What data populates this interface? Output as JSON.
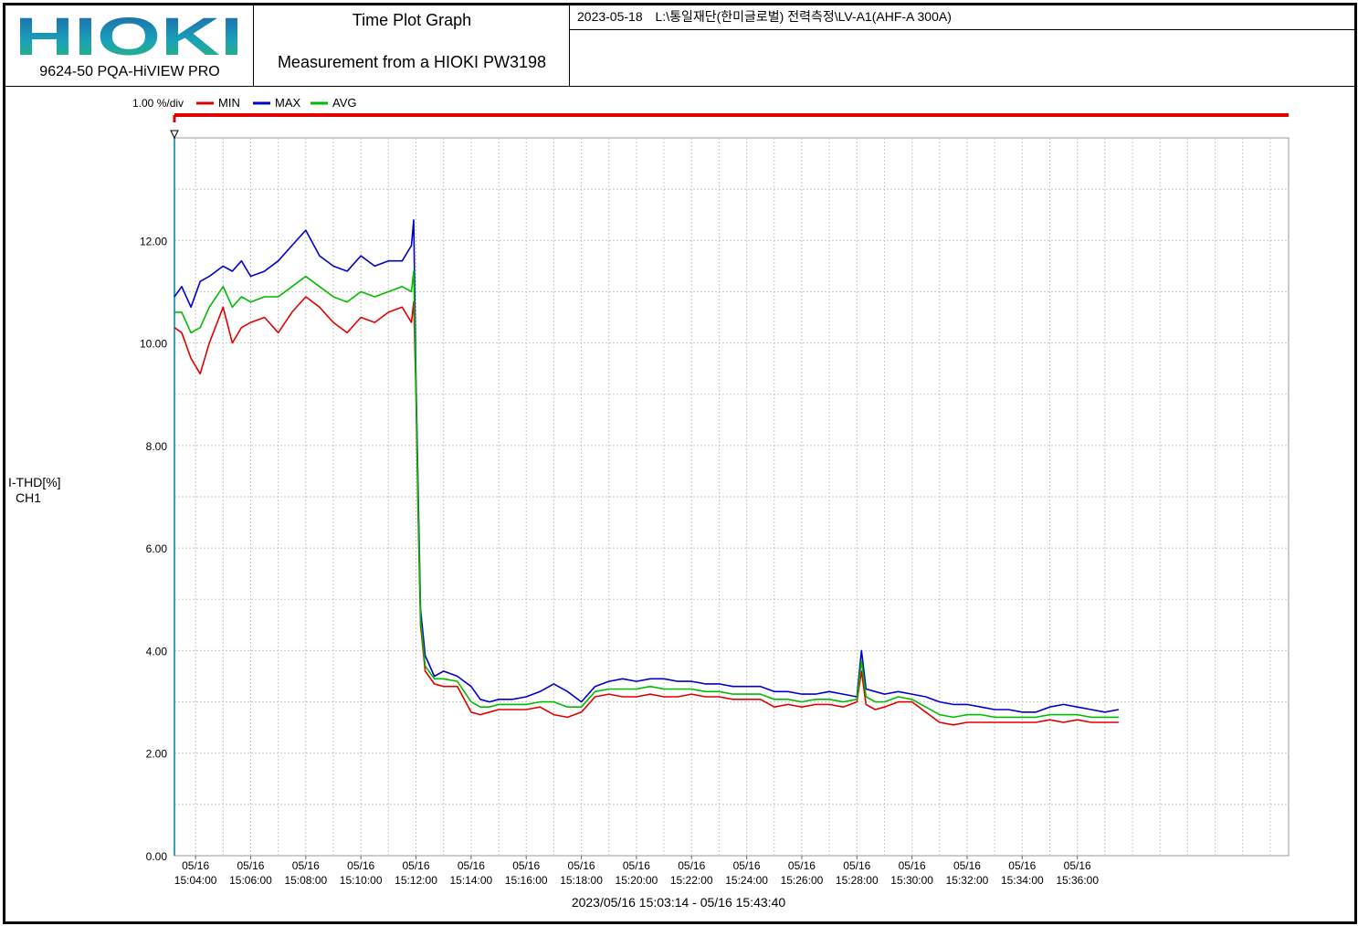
{
  "header": {
    "logo_text": "HIOKI",
    "product": "9624-50 PQA-HiVIEW PRO",
    "title": "Time Plot Graph",
    "subtitle": "Measurement from a HIOKI PW3198",
    "date": "2023-05-18",
    "path": "L:\\통일재단(한미글로벌) 전력측정\\LV-A1(AHF-A 300A)"
  },
  "colors": {
    "min": "#e00000",
    "max": "#0000cc",
    "avg": "#00bb00",
    "marker_bar": "#e00000",
    "cursor": "#3aa0c0",
    "grid": "#c8c8c8"
  },
  "chart_data": {
    "type": "line",
    "scale_label": "1.00 %/div",
    "ylabel": [
      "I-THD[%]",
      "CH1"
    ],
    "ylim": [
      0,
      14
    ],
    "yticks": [
      0,
      2,
      4,
      6,
      8,
      10,
      12
    ],
    "ytick_labels": [
      "0.00",
      "2.00",
      "4.00",
      "6.00",
      "8.00",
      "10.00",
      "12.00"
    ],
    "x_start": "15:03:14",
    "x_end": "15:43:40",
    "xticks": [
      "15:04:00",
      "15:06:00",
      "15:08:00",
      "15:10:00",
      "15:12:00",
      "15:14:00",
      "15:16:00",
      "15:18:00",
      "15:20:00",
      "15:22:00",
      "15:24:00",
      "15:26:00",
      "15:28:00",
      "15:30:00",
      "15:32:00",
      "15:34:00",
      "15:36:00"
    ],
    "xtick_dates": "05/16",
    "range_label": "2023/05/16 15:03:14 - 05/16 15:43:40",
    "x": [
      "15:03:14",
      "15:03:30",
      "15:03:50",
      "15:04:10",
      "15:04:30",
      "15:05:00",
      "15:05:20",
      "15:05:40",
      "15:06:00",
      "15:06:30",
      "15:07:00",
      "15:07:30",
      "15:08:00",
      "15:08:30",
      "15:09:00",
      "15:09:30",
      "15:10:00",
      "15:10:30",
      "15:11:00",
      "15:11:30",
      "15:11:50",
      "15:11:55",
      "15:12:00",
      "15:12:05",
      "15:12:10",
      "15:12:20",
      "15:12:40",
      "15:13:00",
      "15:13:30",
      "15:14:00",
      "15:14:20",
      "15:14:40",
      "15:15:00",
      "15:15:30",
      "15:16:00",
      "15:16:30",
      "15:17:00",
      "15:17:30",
      "15:18:00",
      "15:18:30",
      "15:19:00",
      "15:19:30",
      "15:20:00",
      "15:20:30",
      "15:21:00",
      "15:21:30",
      "15:22:00",
      "15:22:30",
      "15:23:00",
      "15:23:30",
      "15:24:00",
      "15:24:30",
      "15:25:00",
      "15:25:30",
      "15:26:00",
      "15:26:30",
      "15:27:00",
      "15:27:30",
      "15:28:00",
      "15:28:10",
      "15:28:20",
      "15:28:40",
      "15:29:00",
      "15:29:30",
      "15:30:00",
      "15:30:30",
      "15:31:00",
      "15:31:30",
      "15:32:00",
      "15:32:30",
      "15:33:00",
      "15:33:30",
      "15:34:00",
      "15:34:30",
      "15:35:00",
      "15:35:30",
      "15:36:00",
      "15:36:30",
      "15:37:00",
      "15:37:30"
    ],
    "series": [
      {
        "name": "MIN",
        "values": [
          10.3,
          10.2,
          9.7,
          9.4,
          10.0,
          10.7,
          10.0,
          10.3,
          10.4,
          10.5,
          10.2,
          10.6,
          10.9,
          10.7,
          10.4,
          10.2,
          10.5,
          10.4,
          10.6,
          10.7,
          10.4,
          10.8,
          9.0,
          6.5,
          4.5,
          3.6,
          3.35,
          3.3,
          3.3,
          2.8,
          2.75,
          2.8,
          2.85,
          2.85,
          2.85,
          2.9,
          2.75,
          2.7,
          2.8,
          3.1,
          3.15,
          3.1,
          3.1,
          3.15,
          3.1,
          3.1,
          3.15,
          3.1,
          3.1,
          3.05,
          3.05,
          3.05,
          2.9,
          2.95,
          2.9,
          2.95,
          2.95,
          2.9,
          3.0,
          3.6,
          2.95,
          2.85,
          2.9,
          3.0,
          3.0,
          2.8,
          2.6,
          2.55,
          2.6,
          2.6,
          2.6,
          2.6,
          2.6,
          2.6,
          2.65,
          2.6,
          2.65,
          2.6,
          2.6,
          2.6
        ]
      },
      {
        "name": "MAX",
        "values": [
          10.9,
          11.1,
          10.7,
          11.2,
          11.3,
          11.5,
          11.4,
          11.6,
          11.3,
          11.4,
          11.6,
          11.9,
          12.2,
          11.7,
          11.5,
          11.4,
          11.7,
          11.5,
          11.6,
          11.6,
          11.9,
          12.4,
          9.3,
          7.0,
          4.8,
          3.9,
          3.5,
          3.6,
          3.5,
          3.3,
          3.05,
          3.0,
          3.05,
          3.05,
          3.1,
          3.2,
          3.35,
          3.2,
          3.0,
          3.3,
          3.4,
          3.45,
          3.4,
          3.45,
          3.45,
          3.4,
          3.4,
          3.35,
          3.35,
          3.3,
          3.3,
          3.3,
          3.2,
          3.2,
          3.15,
          3.15,
          3.2,
          3.15,
          3.1,
          4.0,
          3.25,
          3.2,
          3.15,
          3.2,
          3.15,
          3.1,
          3.0,
          2.95,
          2.95,
          2.9,
          2.85,
          2.85,
          2.8,
          2.8,
          2.9,
          2.95,
          2.9,
          2.85,
          2.8,
          2.85
        ]
      },
      {
        "name": "AVG",
        "values": [
          10.6,
          10.6,
          10.2,
          10.3,
          10.7,
          11.1,
          10.7,
          10.9,
          10.8,
          10.9,
          10.9,
          11.1,
          11.3,
          11.1,
          10.9,
          10.8,
          11.0,
          10.9,
          11.0,
          11.1,
          11.0,
          11.4,
          9.1,
          6.7,
          4.6,
          3.7,
          3.45,
          3.45,
          3.4,
          3.0,
          2.9,
          2.9,
          2.95,
          2.95,
          2.95,
          3.0,
          3.0,
          2.9,
          2.9,
          3.2,
          3.25,
          3.25,
          3.25,
          3.3,
          3.25,
          3.25,
          3.25,
          3.2,
          3.2,
          3.15,
          3.15,
          3.15,
          3.05,
          3.05,
          3.0,
          3.05,
          3.05,
          3.0,
          3.05,
          3.8,
          3.1,
          3.0,
          3.0,
          3.1,
          3.05,
          2.9,
          2.75,
          2.7,
          2.75,
          2.75,
          2.7,
          2.7,
          2.7,
          2.7,
          2.75,
          2.75,
          2.75,
          2.7,
          2.7,
          2.7
        ]
      }
    ],
    "legend": [
      "MIN",
      "MAX",
      "AVG"
    ],
    "legend_position": "top-left",
    "grid": true
  }
}
